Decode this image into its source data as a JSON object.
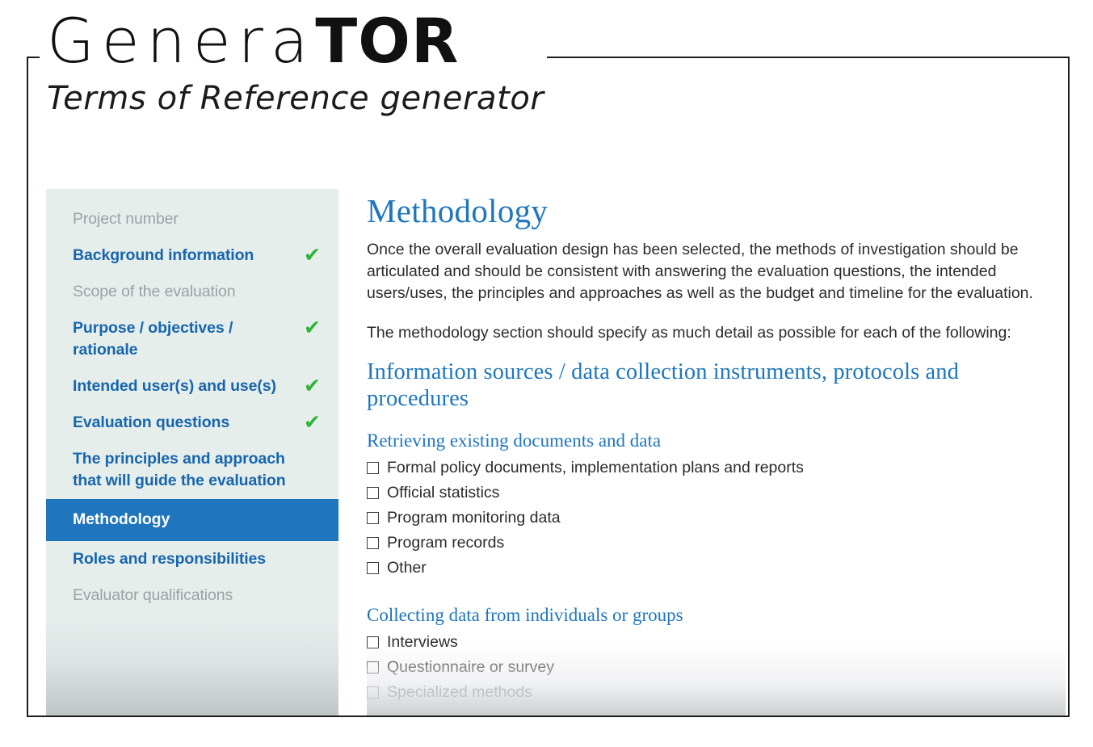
{
  "brand": {
    "name_light": "Genera",
    "name_bold": "TOR",
    "tagline": "Terms of Reference generator"
  },
  "colors": {
    "accent_blue": "#1f76bc",
    "link_blue": "#1766ad",
    "check_green": "#2fb339",
    "sidebar_bg": "#e6eeec",
    "disabled_gray": "#9aa3a3"
  },
  "sidebar": {
    "items": [
      {
        "label": "Project number",
        "state": "disabled",
        "completed": false,
        "check": ""
      },
      {
        "label": "Background information",
        "state": "enabled",
        "completed": true,
        "check": "✔"
      },
      {
        "label": "Scope of the evaluation",
        "state": "disabled",
        "completed": false,
        "check": ""
      },
      {
        "label": "Purpose / objectives / rationale",
        "state": "enabled",
        "completed": true,
        "check": "✔"
      },
      {
        "label": "Intended user(s) and use(s)",
        "state": "enabled",
        "completed": true,
        "check": "✔"
      },
      {
        "label": "Evaluation questions",
        "state": "enabled",
        "completed": true,
        "check": "✔"
      },
      {
        "label": "The principles and approach that will guide the evaluation",
        "state": "enabled",
        "completed": false,
        "check": ""
      },
      {
        "label": "Methodology",
        "state": "active",
        "completed": false,
        "check": ""
      },
      {
        "label": "Roles and responsibilities",
        "state": "enabled",
        "completed": false,
        "check": ""
      },
      {
        "label": "Evaluator qualifications",
        "state": "disabled",
        "completed": false,
        "check": ""
      }
    ]
  },
  "main": {
    "title": "Methodology",
    "paragraph_1": "Once the overall evaluation design has been selected, the methods of investigation should be articulated and should be consistent with answering the evaluation questions, the intended users/uses, the principles and approaches as well as the budget and timeline for the evaluation.",
    "paragraph_2": "The methodology section should specify as much detail as possible for each of the following:",
    "section_heading": "Information sources / data collection instruments, protocols and procedures",
    "groups": [
      {
        "heading": "Retrieving existing documents and data",
        "options": [
          {
            "label": "Formal policy documents, implementation plans and reports",
            "checked": false
          },
          {
            "label": "Official statistics",
            "checked": false
          },
          {
            "label": "Program monitoring data",
            "checked": false
          },
          {
            "label": "Program records",
            "checked": false
          },
          {
            "label": "Other",
            "checked": false
          }
        ]
      },
      {
        "heading": "Collecting data from individuals or groups",
        "options": [
          {
            "label": "Interviews",
            "checked": false
          },
          {
            "label": "Questionnaire or survey",
            "checked": false
          },
          {
            "label": "Specialized methods",
            "checked": false
          }
        ]
      }
    ]
  }
}
